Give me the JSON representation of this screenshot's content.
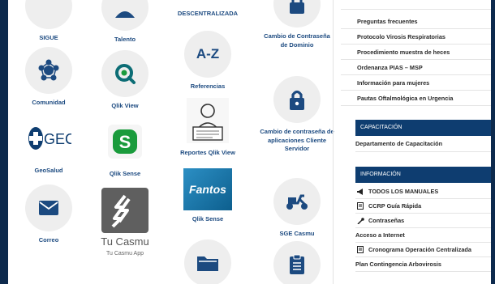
{
  "tiles": {
    "col1": {
      "sigue": "SIGUE",
      "comunidad": "Comunidad",
      "geosalud": "GeoSalud",
      "geosalud_logo_text": "GEC",
      "correo": "Correo"
    },
    "col2": {
      "talento": "Talento",
      "qlik_view": "Qlik View",
      "qlik_sense": "Qlik Sense",
      "tu_casmu": "Tu Casmu",
      "tu_casmu_app": "Tu Casmu App"
    },
    "col3": {
      "descentralizada": "DESCENTRALIZADA",
      "az_text": "A-Z",
      "referencias": "Referencias",
      "reportes_qlik_view": "Reportes Qlik View",
      "fantos_text": "Fantos",
      "qlik_sense": "Qlik Sense"
    },
    "col4": {
      "cambio_dominio": "Cambio de Contraseña de Dominio",
      "cambio_aplicaciones": "Cambio de contraseña de aplicaciones Cliente Servidor",
      "sge_casmu": "SGE Casmu"
    }
  },
  "links": [
    "Preguntas frecuentes",
    "Protocolo Virosis Respiratorias",
    "Procedimiento muestra de heces",
    "Ordenanza PIAS – MSP",
    "Información para mujeres",
    "Pautas Oftalmológica en Urgencia"
  ],
  "capacitacion": {
    "header": "CAPACITACIÓN",
    "items": [
      "Departamento de Capacitación"
    ]
  },
  "informacion": {
    "header": "INFORMACIÓN",
    "items": [
      "TODOS LOS MANUALES",
      "CCRP Guía Rápida",
      "Contraseñas",
      "Acceso a Internet",
      "Cronograma Operación Centralizada",
      "Plan Contingencia Arbovirosis"
    ]
  },
  "colors": {
    "navy": "#0e3d70",
    "label_blue": "#1c4a80",
    "qlik_green": "#1a9b3c",
    "qlik_teal": "#0c6d75",
    "tile_bg": "#eeeeee"
  }
}
